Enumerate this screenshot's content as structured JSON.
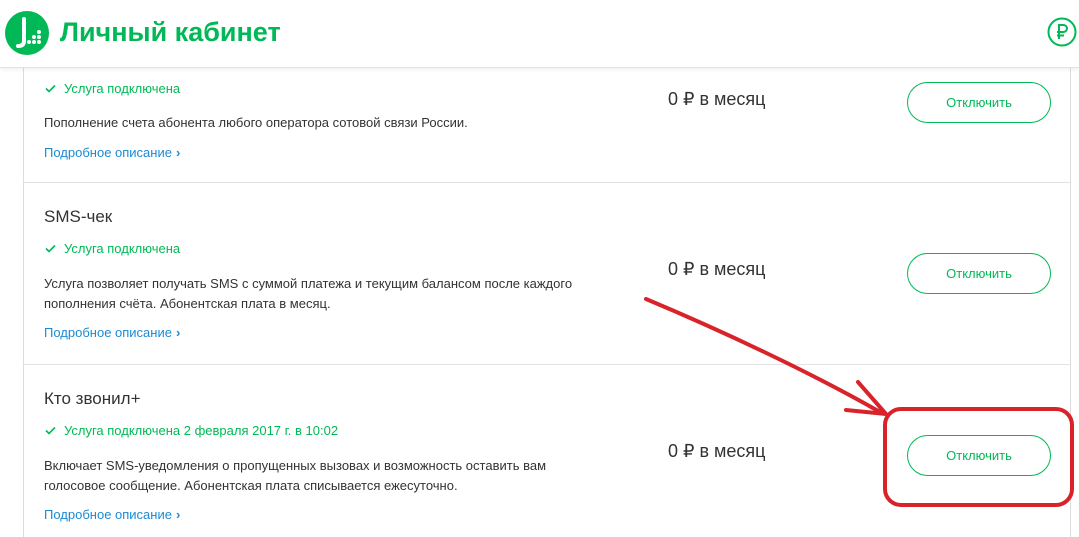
{
  "header": {
    "title": "Личный кабинет",
    "logo_icon": "megafon-logo-icon",
    "ruble_icon": "ruble-icon",
    "brand_color": "#00b956"
  },
  "services": [
    {
      "name": "",
      "status": "Услуга подключена",
      "description": "Пополнение счета абонента любого оператора сотовой связи России.",
      "more_link": "Подробное описание",
      "price": "0 ₽ в месяц",
      "button": "Отключить"
    },
    {
      "name": "SMS-чек",
      "status": "Услуга подключена",
      "description": "Услуга позволяет получать SMS с суммой платежа и текущим балансом после каждого пополнения счёта. Абонентская плата в месяц.",
      "more_link": "Подробное описание",
      "price": "0 ₽ в месяц",
      "button": "Отключить"
    },
    {
      "name": "Кто звонил+",
      "status": "Услуга подключена 2 февраля 2017 г. в 10:02",
      "description": "Включает SMS-уведомления о пропущенных вызовах и возможность оставить вам голосовое сообщение. Абонентская плата списывается ежесуточно.",
      "more_link": "Подробное описание",
      "price": "0 ₽ в месяц",
      "button": "Отключить"
    }
  ],
  "annotation": {
    "color": "#d9232a",
    "shapes": [
      "red-arrow",
      "red-highlight-box"
    ]
  }
}
